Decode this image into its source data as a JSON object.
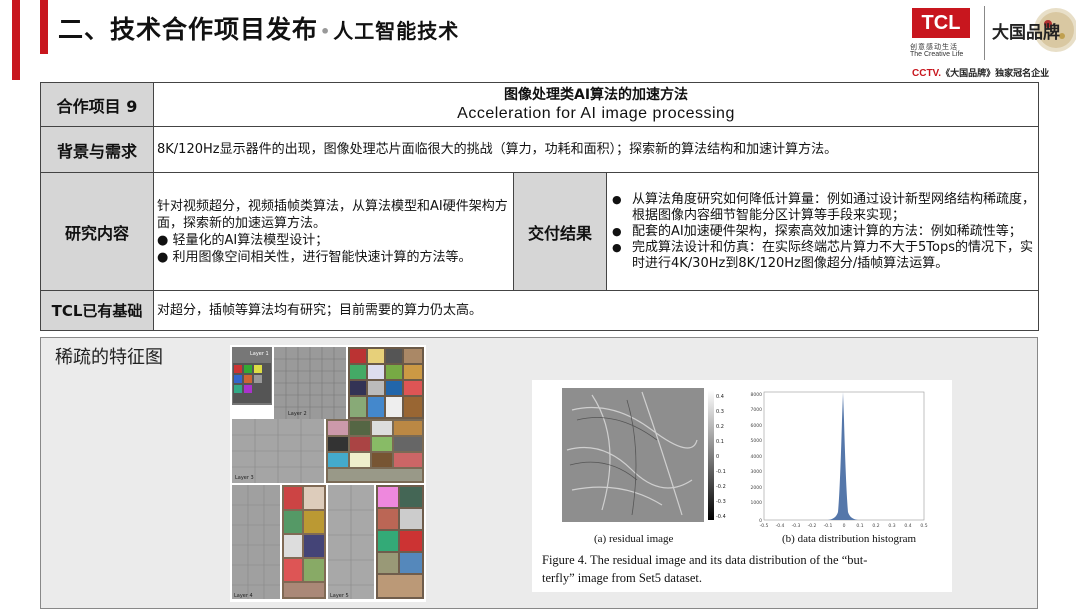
{
  "header": {
    "title_main": "二、技术合作项目发布",
    "title_sep": "•",
    "title_sub": "人工智能技术",
    "brand_logo": "TCL",
    "brand_slogan_cn": "创意感动生活",
    "brand_slogan_en": "The Creative Life",
    "partner_logo_text": "大国品牌",
    "cctv_line_logo": "CCTV.",
    "cctv_line_text": "《大国品牌》独家冠名企业"
  },
  "table": {
    "project_label": "合作项目 9",
    "project_title_cn": "图像处理类AI算法的加速方法",
    "project_title_en": "Acceleration for AI image processing",
    "bg_label": "背景与需求",
    "bg_text": "8K/120Hz显示器件的出现，图像处理芯片面临很大的挑战（算力，功耗和面积）；探索新的算法结构和加速计算方法。",
    "research_label": "研究内容",
    "research_lines": [
      "针对视频超分，视频插帧类算法，从算法模型和AI硬件架构方面，探索新的加速运算方法。",
      "●  轻量化的AI算法模型设计；",
      "●  利用图像空间相关性，进行智能快速计算的方法等。"
    ],
    "deliver_label": "交付结果",
    "deliver_items": [
      "从算法角度研究如何降低计算量：例如通过设计新型网络结构稀疏度，根据图像内容细节智能分区计算等手段来实现；",
      "配套的AI加速硬件架构，探索高效加速计算的方法：例如稀疏性等；",
      "完成算法设计和仿真：在实际终端芯片算力不大于5Tops的情况下，实时进行4K/30Hz到8K/120Hz图像超分/插帧算法运算。"
    ],
    "base_label": "TCL已有基础",
    "base_text": "对超分，插帧等算法均有研究；目前需要的算力仍太高。"
  },
  "figure": {
    "label": "稀疏的特征图",
    "layer_labels": [
      "Layer 1",
      "Layer 2",
      "Layer 3",
      "Layer 4",
      "Layer 5"
    ],
    "colorbar_ticks": [
      "0.4",
      "0.3",
      "0.2",
      "0.1",
      "0",
      "-0.1",
      "-0.2",
      "-0.3",
      "-0.4"
    ],
    "hist_yticks": [
      "8000",
      "7000",
      "6000",
      "5000",
      "4000",
      "3000",
      "2000",
      "1000",
      "0"
    ],
    "hist_xticks": [
      "-0.5",
      "-0.4",
      "-0.3",
      "-0.2",
      "-0.1",
      "0",
      "0.1",
      "0.2",
      "0.3",
      "0.4",
      "0.5"
    ],
    "caption_a": "(a) residual image",
    "caption_b": "(b) data distribution histogram",
    "figure_caption_1": "Figure 4. The residual image and its data distribution of the “but-",
    "figure_caption_2": "terfly” image from Set5 dataset."
  }
}
